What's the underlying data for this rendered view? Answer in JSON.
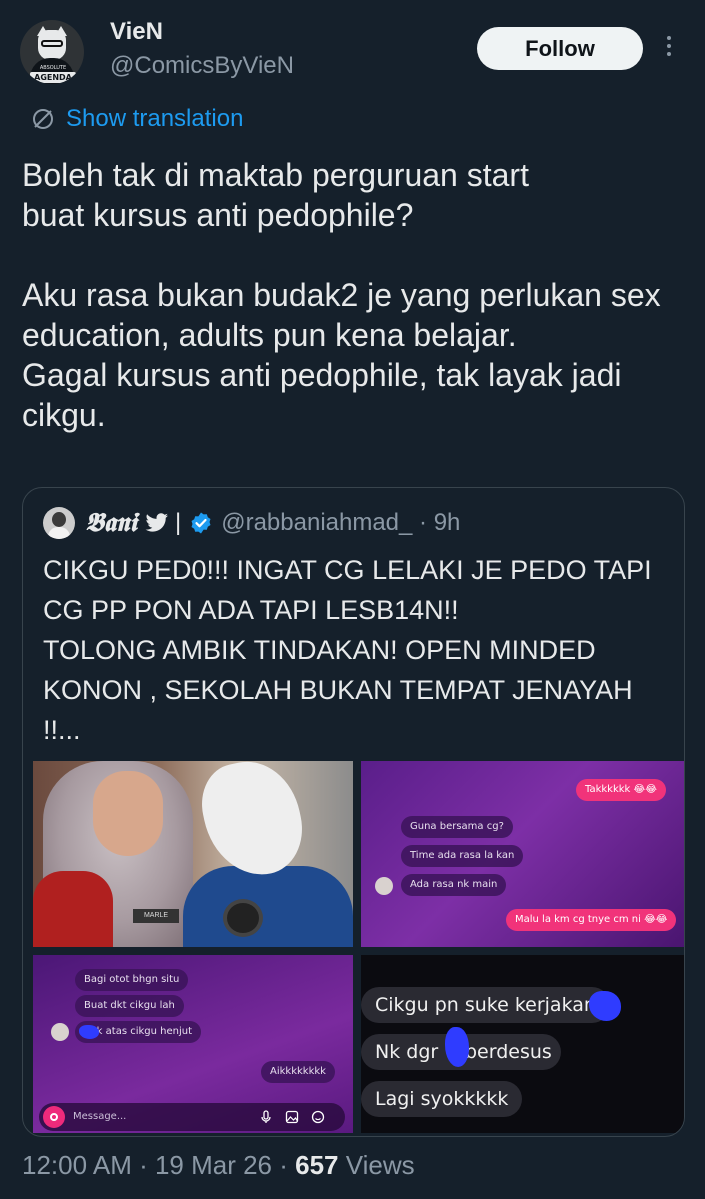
{
  "author": {
    "name": "VieN",
    "handle": "@ComicsByVieN",
    "avatar_text_top": "ABSOLUTE",
    "avatar_text": "AGENDA"
  },
  "actions": {
    "follow_label": "Follow",
    "more_icon": "more-vertical-icon"
  },
  "translation": {
    "label": "Show translation",
    "icon": "translate-icon"
  },
  "tweet": {
    "text": "Boleh tak di maktab perguruan start\nbuat kursus anti pedophile?\n\nAku rasa bukan budak2 je yang perlukan sex education, adults pun kena belajar.\nGagal kursus anti pedophile, tak layak jadi cikgu."
  },
  "quote": {
    "name": "𝕭𝖆𝖓𝖎",
    "separator": "|",
    "handle": "@rabbaniahmad_ · 9h",
    "text": "CIKGU PED0!!! INGAT CG LELAKI JE PEDO TAPI CG PP PON ADA TAPI LESB14N!!\nTOLONG AMBIK TINDAKAN! OPEN MINDED KONON , SEKOLAH BUKAN TEMPAT JENAYAH !!...",
    "media": {
      "photo": {
        "nametag": "MARLE"
      },
      "chat1": {
        "top_out": "Takkkkkk 😂😂",
        "in": [
          "Guna bersama cg?",
          "Time ada rasa la kan",
          "Ada rasa nk main"
        ],
        "out": "Malu la km cg tnye cm ni 😂😂"
      },
      "chat2": {
        "in": [
          "Bagi otot bhgn situ",
          "Buat dkt cikgu lah",
          "duk atas cikgu henjut"
        ],
        "out": "Aikkkkkkkk",
        "placeholder": "Message..."
      },
      "chat3": {
        "lines": [
          "Cikgu pn suke kerjakan",
          "Nk dgr",
          "berdesus",
          "Lagi syokkkkk"
        ]
      }
    }
  },
  "meta": {
    "time": "12:00 AM · 19 Mar 26 · ",
    "views_count": "657",
    "views_label": " Views"
  },
  "colors": {
    "background": "#15202b",
    "link": "#1d9bf0",
    "secondary": "#8b98a5",
    "verified": "#1d9bf0"
  }
}
